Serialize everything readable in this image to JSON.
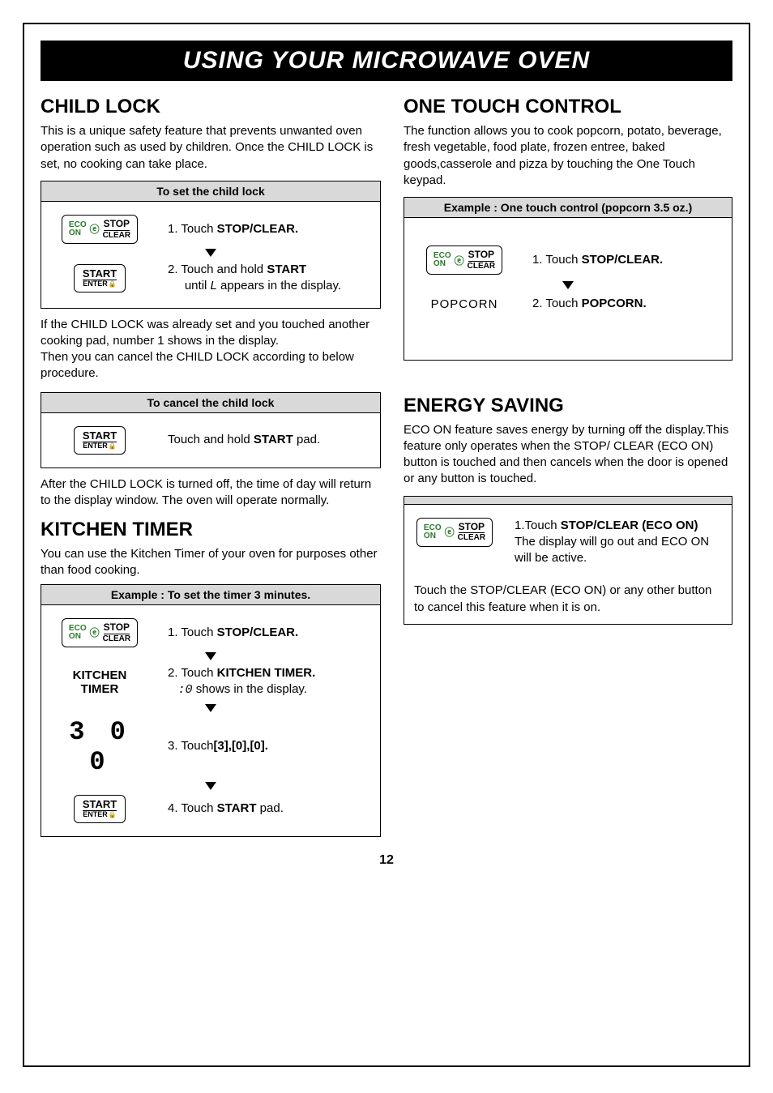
{
  "title_bar": "USING YOUR MICROWAVE OVEN",
  "page_number": "12",
  "left": {
    "child_lock": {
      "heading": "CHILD LOCK",
      "intro": "This is a unique safety feature that prevents unwanted oven operation such as used by children. Once the CHILD LOCK is set, no cooking can take place.",
      "set_box": {
        "header": "To set the child lock",
        "step1": "1. Touch STOP/CLEAR.",
        "step2_pre": "2. Touch and hold ",
        "step2_bold": "START",
        "step2_mid": " until ",
        "step2_glyph": "L",
        "step2_post": " appears in the display."
      },
      "mid_note": "If the CHILD LOCK was already set and you touched another cooking pad, number 1 shows in the display.\nThen you can cancel the CHILD LOCK according to below procedure.",
      "cancel_box": {
        "header": "To cancel the child lock",
        "step": "Touch and hold START pad."
      },
      "after_note": "After the CHILD LOCK is turned off, the time of day will return to the display window. The oven will operate normally."
    },
    "kitchen_timer": {
      "heading": "KITCHEN TIMER",
      "intro": "You can use the Kitchen Timer of your oven for purposes other than food cooking.",
      "box": {
        "header": "Example : To set the timer 3 minutes.",
        "step1": "1. Touch STOP/CLEAR.",
        "step2_pre": "2. Touch ",
        "step2_bold": "KITCHEN  TIMER.",
        "step2_line2_glyph": ":0",
        "step2_line2_post": "  shows in the display.",
        "digits": "3 0 0",
        "step3": "3. Touch[3],[0],[0].",
        "step4": "4. Touch START pad."
      }
    }
  },
  "right": {
    "one_touch": {
      "heading": "ONE TOUCH CONTROL",
      "intro": "The function allows you to cook popcorn, potato, beverage, fresh vegetable, food plate, frozen entree, baked goods,casserole and pizza by touching the One Touch keypad.",
      "box": {
        "header": "Example : One touch control (popcorn 3.5 oz.)",
        "step1": "1. Touch STOP/CLEAR.",
        "step2_btn": "POPCORN",
        "step2": "2. Touch POPCORN."
      }
    },
    "energy": {
      "heading": "ENERGY SAVING",
      "intro": "ECO ON feature saves energy by turning off the display.This feature only operates when the STOP/ CLEAR (ECO ON) button is touched and then cancels when the door is opened or any button is touched.",
      "box": {
        "step1_line1": "1.Touch STOP/CLEAR (ECO ON)",
        "step1_line2": "The display will go out and ECO ON will be active.",
        "footer": "Touch the STOP/CLEAR (ECO ON)  or any other button to cancel this feature when it is on."
      }
    }
  },
  "buttons": {
    "eco": "ECO",
    "on": "ON",
    "stop": "STOP",
    "clear": "CLEAR",
    "start": "START",
    "enter": "ENTER",
    "kitchen": "KITCHEN",
    "timer": "TIMER"
  }
}
